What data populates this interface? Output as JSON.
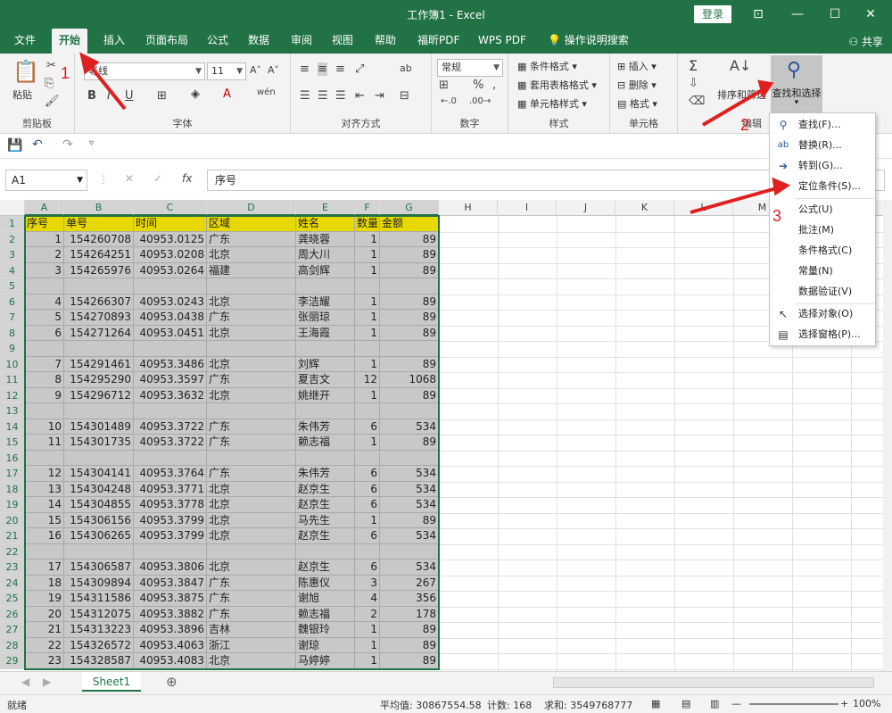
{
  "window": {
    "title": "工作簿1  -  Excel",
    "login_label": "登录",
    "win_controls": [
      "⊡",
      "—",
      "☐",
      "✕"
    ]
  },
  "tabs": [
    "文件",
    "开始",
    "插入",
    "页面布局",
    "公式",
    "数据",
    "审阅",
    "视图",
    "帮助",
    "福昕PDF",
    "WPS PDF",
    "操作说明搜索"
  ],
  "share_label": "共享",
  "ribbon": {
    "clipboard": {
      "paste_label": "粘贴",
      "group_label": "剪贴板"
    },
    "font": {
      "font_name": "等线",
      "font_size": "11",
      "group_label": "字体",
      "bold": "B",
      "italic": "I",
      "underline": "U"
    },
    "align": {
      "group_label": "对齐方式"
    },
    "number": {
      "format": "常规",
      "group_label": "数字",
      "percent": "%"
    },
    "styles": {
      "items": [
        "条件格式",
        "套用表格格式",
        "单元格样式"
      ],
      "group_label": "样式"
    },
    "cells": {
      "items": [
        "插入",
        "删除",
        "格式"
      ],
      "group_label": "单元格"
    },
    "edit": {
      "sort_filter": "排序和筛选",
      "find_select": "查找和选择",
      "group_label": "编辑"
    }
  },
  "formula": {
    "name_box": "A1",
    "fx": "fx",
    "content": "序号"
  },
  "columns": [
    "A",
    "B",
    "C",
    "D",
    "E",
    "F",
    "G",
    "H",
    "I",
    "J",
    "K",
    "L",
    "M"
  ],
  "table": {
    "headers": [
      "序号",
      "单号",
      "时间",
      "区域",
      "姓名",
      "数量",
      "金额"
    ],
    "rows": [
      [
        "1",
        "154260708",
        "40953.0125",
        "广东",
        "龚晓蓉",
        "1",
        "89"
      ],
      [
        "2",
        "154264251",
        "40953.0208",
        "北京",
        "周大川",
        "1",
        "89"
      ],
      [
        "3",
        "154265976",
        "40953.0264",
        "福建",
        "高剑辉",
        "1",
        "89"
      ],
      [
        "",
        "",
        "",
        "",
        "",
        "",
        ""
      ],
      [
        "4",
        "154266307",
        "40953.0243",
        "北京",
        "李洁耀",
        "1",
        "89"
      ],
      [
        "5",
        "154270893",
        "40953.0438",
        "广东",
        "张丽琼",
        "1",
        "89"
      ],
      [
        "6",
        "154271264",
        "40953.0451",
        "北京",
        "王海霞",
        "1",
        "89"
      ],
      [
        "",
        "",
        "",
        "",
        "",
        "",
        ""
      ],
      [
        "7",
        "154291461",
        "40953.3486",
        "北京",
        "刘辉",
        "1",
        "89"
      ],
      [
        "8",
        "154295290",
        "40953.3597",
        "广东",
        "夏吉文",
        "12",
        "1068"
      ],
      [
        "9",
        "154296712",
        "40953.3632",
        "北京",
        "姚继开",
        "1",
        "89"
      ],
      [
        "",
        "",
        "",
        "",
        "",
        "",
        ""
      ],
      [
        "10",
        "154301489",
        "40953.3722",
        "广东",
        "朱伟芳",
        "6",
        "534"
      ],
      [
        "11",
        "154301735",
        "40953.3722",
        "广东",
        "赖志福",
        "1",
        "89"
      ],
      [
        "",
        "",
        "",
        "",
        "",
        "",
        ""
      ],
      [
        "12",
        "154304141",
        "40953.3764",
        "广东",
        "朱伟芳",
        "6",
        "534"
      ],
      [
        "13",
        "154304248",
        "40953.3771",
        "北京",
        "赵京生",
        "6",
        "534"
      ],
      [
        "14",
        "154304855",
        "40953.3778",
        "北京",
        "赵京生",
        "6",
        "534"
      ],
      [
        "15",
        "154306156",
        "40953.3799",
        "北京",
        "马先生",
        "1",
        "89"
      ],
      [
        "16",
        "154306265",
        "40953.3799",
        "北京",
        "赵京生",
        "6",
        "534"
      ],
      [
        "",
        "",
        "",
        "",
        "",
        "",
        ""
      ],
      [
        "17",
        "154306587",
        "40953.3806",
        "北京",
        "赵京生",
        "6",
        "534"
      ],
      [
        "18",
        "154309894",
        "40953.3847",
        "广东",
        "陈惠仪",
        "3",
        "267"
      ],
      [
        "19",
        "154311586",
        "40953.3875",
        "广东",
        "谢旭",
        "4",
        "356"
      ],
      [
        "20",
        "154312075",
        "40953.3882",
        "广东",
        "赖志福",
        "2",
        "178"
      ],
      [
        "21",
        "154313223",
        "40953.3896",
        "吉林",
        "魏银玲",
        "1",
        "89"
      ],
      [
        "22",
        "154326572",
        "40953.4063",
        "浙江",
        "谢琼",
        "1",
        "89"
      ],
      [
        "23",
        "154328587",
        "40953.4083",
        "北京",
        "马婷婷",
        "1",
        "89"
      ]
    ]
  },
  "menu": {
    "items": [
      {
        "icon": "search-icon",
        "glyph": "⚲",
        "label": "查找(F)..."
      },
      {
        "icon": "replace-icon",
        "glyph": "ab",
        "label": "替换(R)..."
      },
      {
        "icon": "goto-arrow-icon",
        "glyph": "➔",
        "label": "转到(G)..."
      },
      {
        "icon": "",
        "glyph": "",
        "label": "定位条件(S)..."
      },
      {
        "icon": "",
        "glyph": "",
        "label": "公式(U)"
      },
      {
        "icon": "",
        "glyph": "",
        "label": "批注(M)"
      },
      {
        "icon": "",
        "glyph": "",
        "label": "条件格式(C)"
      },
      {
        "icon": "",
        "glyph": "",
        "label": "常量(N)"
      },
      {
        "icon": "",
        "glyph": "",
        "label": "数据验证(V)"
      },
      {
        "icon": "cursor-icon",
        "glyph": "↖",
        "label": "选择对象(O)"
      },
      {
        "icon": "selection-pane-icon",
        "glyph": "▤",
        "label": "选择窗格(P)..."
      }
    ]
  },
  "sheet_tab": "Sheet1",
  "status": {
    "ready": "就绪",
    "average": "平均值: 30867554.58",
    "count": "计数: 168",
    "sum": "求和: 3549768777",
    "zoom": "100%"
  },
  "annotations": [
    "1",
    "2",
    "3"
  ],
  "colors": {
    "brand": "#217346",
    "header_fill": "#e6d800",
    "body_fill": "#c8c8c8",
    "annotation": "#e02020"
  }
}
